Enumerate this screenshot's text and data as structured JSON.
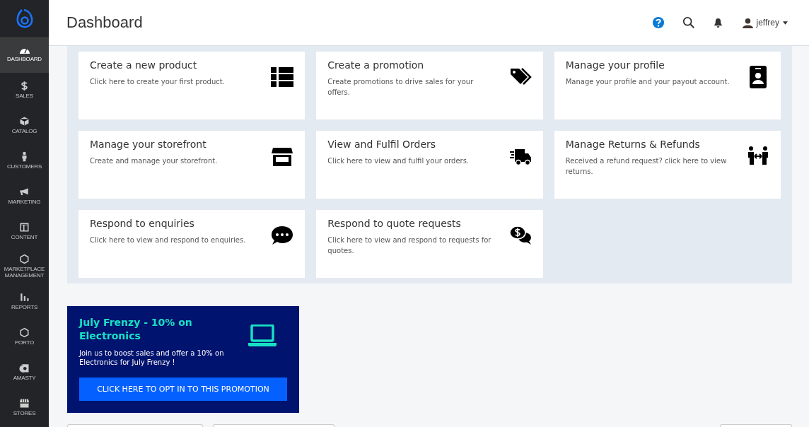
{
  "sidebar": {
    "items": [
      {
        "label": "DASHBOARD",
        "kind": "gauge",
        "selected": true
      },
      {
        "label": "SALES",
        "kind": "dollar",
        "selected": false
      },
      {
        "label": "CATALOG",
        "kind": "box",
        "selected": false
      },
      {
        "label": "CUSTOMERS",
        "kind": "person",
        "selected": false
      },
      {
        "label": "MARKETING",
        "kind": "megaphone",
        "selected": false
      },
      {
        "label": "CONTENT",
        "kind": "layout",
        "selected": false
      },
      {
        "label": "MARKETPLACE MANAGEMENT",
        "kind": "hexagon",
        "selected": false
      },
      {
        "label": "REPORTS",
        "kind": "bars",
        "selected": false
      },
      {
        "label": "PORTO",
        "kind": "hexagon",
        "selected": false
      },
      {
        "label": "AMASTY",
        "kind": "amasty",
        "selected": false
      },
      {
        "label": "STORES",
        "kind": "store",
        "selected": false
      }
    ]
  },
  "header": {
    "title": "Dashboard",
    "user": "jeffrey"
  },
  "cards": [
    {
      "title": "Create a new product",
      "text": "Click here to create your first product.",
      "kind": "list"
    },
    {
      "title": "Create a promotion",
      "text": "Create promotions to drive sales for your offers.",
      "kind": "tags"
    },
    {
      "title": "Manage your profile",
      "text": "Manage your profile and your payout account.",
      "kind": "badge"
    },
    {
      "title": "Manage your storefront",
      "text": "Create and manage your storefront.",
      "kind": "store"
    },
    {
      "title": "View and Fulfil Orders",
      "text": "Click here to view and fulfil your orders.",
      "kind": "truck"
    },
    {
      "title": "Manage Returns & Refunds",
      "text": "Received a refund request? click here to view returns.",
      "kind": "exchange"
    },
    {
      "title": "Respond to enquiries",
      "text": "Click here to view and respond to enquiries.",
      "kind": "chat"
    },
    {
      "title": "Respond to quote requests",
      "text": "Click here to view and respond to requests for quotes.",
      "kind": "quote"
    }
  ],
  "promotion": {
    "title": "July Frenzy - 10% on Electronics",
    "text": "Join us to boost sales and offer a 10% on Electronics for July Frenzy !",
    "button": "CLICK HERE TO OPT IN TO THIS PROMOTION"
  }
}
